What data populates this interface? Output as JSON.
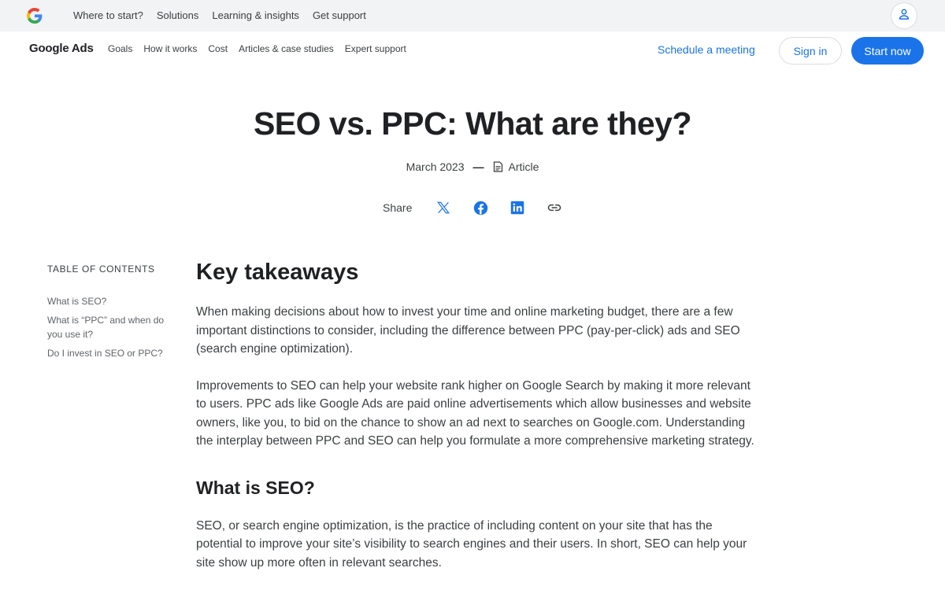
{
  "topbar": {
    "links": [
      "Where to start?",
      "Solutions",
      "Learning & insights",
      "Get support"
    ]
  },
  "header": {
    "brand": "Google Ads",
    "nav": [
      "Goals",
      "How it works",
      "Cost",
      "Articles & case studies",
      "Expert support"
    ],
    "schedule_label": "Schedule a meeting",
    "signin_label": "Sign in",
    "start_label": "Start now"
  },
  "hero": {
    "title": "SEO vs. PPC: What are they?",
    "date": "March 2023",
    "dash": "—",
    "type": "Article",
    "share_label": "Share",
    "share_icons": [
      "x-icon",
      "facebook-icon",
      "linkedin-icon",
      "link-icon"
    ]
  },
  "toc": {
    "heading": "TABLE OF CONTENTS",
    "items": [
      "What is SEO?",
      "What is “PPC” and when do you use it?",
      "Do I invest in SEO or PPC?"
    ]
  },
  "article": {
    "heading": "Key takeaways",
    "paragraphs": [
      "When making decisions about how to invest your time and online marketing budget, there are a few important distinctions to consider, including the difference between PPC (pay-per-click) ads and SEO (search engine optimization).",
      "Improvements to SEO can help your website rank higher on Google Search by making it more relevant to users. PPC ads like Google Ads are paid online advertisements which allow businesses and website owners, like you, to bid on the chance to show an ad next to searches on Google.com. Understanding the interplay between PPC and SEO can help you formulate a more comprehensive marketing strategy."
    ],
    "section_heading": "What is SEO?",
    "section_paragraph": "SEO, or search engine optimization, is the practice of including content on your site that has the potential to improve your site’s visibility to search engines and their users. In short, SEO can help your site show up more often in relevant searches."
  },
  "colors": {
    "accent": "#1a73e8",
    "topbar_bg": "#f1f3f4",
    "text": "#202124"
  }
}
